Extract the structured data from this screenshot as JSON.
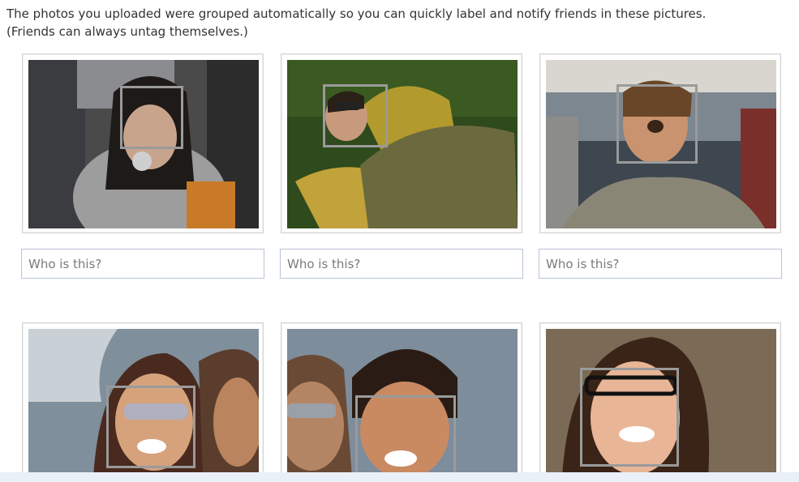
{
  "intro": {
    "line1": "The photos you uploaded were grouped automatically so you can quickly label and notify friends in these pictures.",
    "line2": "(Friends can always untag themselves.)"
  },
  "tag_input": {
    "placeholder": "Who is this?"
  },
  "photos": [
    {
      "name": "photo-1"
    },
    {
      "name": "photo-2"
    },
    {
      "name": "photo-3"
    },
    {
      "name": "photo-4"
    },
    {
      "name": "photo-5"
    },
    {
      "name": "photo-6"
    }
  ],
  "colors": {
    "card_border": "#d4d4d4",
    "face_box": "#9a9a9a",
    "input_border": "#b9c3d6",
    "bottom_bar": "#eaf0f8"
  }
}
